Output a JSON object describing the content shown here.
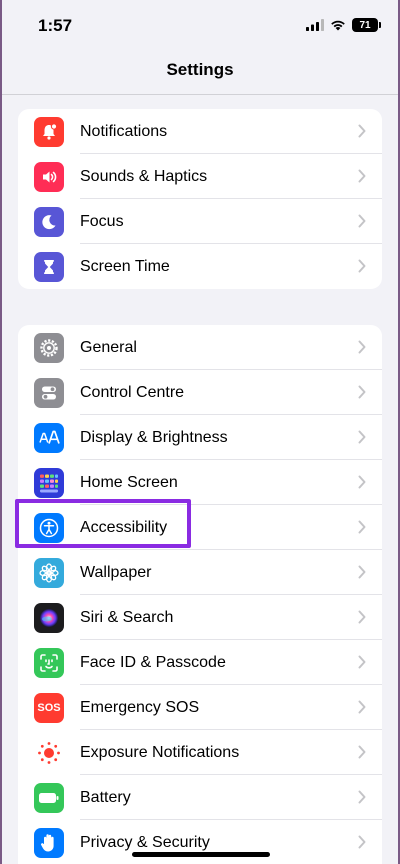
{
  "status_bar": {
    "time": "1:57",
    "battery_level": "71",
    "icons": [
      "cellular-signal-icon",
      "wifi-icon",
      "battery-icon"
    ]
  },
  "navigation": {
    "title": "Settings"
  },
  "groups": [
    {
      "items": [
        {
          "label": "Notifications",
          "icon": "bell-icon",
          "color": "#ff3b30"
        },
        {
          "label": "Sounds & Haptics",
          "icon": "speaker-icon",
          "color": "#ff2d55"
        },
        {
          "label": "Focus",
          "icon": "moon-icon",
          "color": "#5856d6"
        },
        {
          "label": "Screen Time",
          "icon": "hourglass-icon",
          "color": "#5856d6"
        }
      ]
    },
    {
      "items": [
        {
          "label": "General",
          "icon": "gear-icon",
          "color": "#8e8e93"
        },
        {
          "label": "Control Centre",
          "icon": "toggles-icon",
          "color": "#8e8e93"
        },
        {
          "label": "Display & Brightness",
          "icon": "text-size-icon",
          "color": "#007aff"
        },
        {
          "label": "Home Screen",
          "icon": "app-grid-icon",
          "color": "#2f3bd8"
        },
        {
          "label": "Accessibility",
          "icon": "accessibility-icon",
          "color": "#007aff"
        },
        {
          "label": "Wallpaper",
          "icon": "flower-icon",
          "color": "#34aadc"
        },
        {
          "label": "Siri & Search",
          "icon": "siri-icon",
          "color": "#1c1c1e"
        },
        {
          "label": "Face ID & Passcode",
          "icon": "face-id-icon",
          "color": "#34c759"
        },
        {
          "label": "Emergency SOS",
          "icon": "sos-icon",
          "color": "#ff3b30",
          "icon_text": "SOS"
        },
        {
          "label": "Exposure Notifications",
          "icon": "exposure-icon",
          "color": "#ffffff"
        },
        {
          "label": "Battery",
          "icon": "battery-icon",
          "color": "#34c759"
        },
        {
          "label": "Privacy & Security",
          "icon": "hand-icon",
          "color": "#007aff"
        }
      ]
    }
  ],
  "highlighted_item": "Accessibility",
  "colors": {
    "highlight_border": "#8a2be2",
    "background": "#f2f2f7",
    "chevron": "#c4c4c7"
  }
}
